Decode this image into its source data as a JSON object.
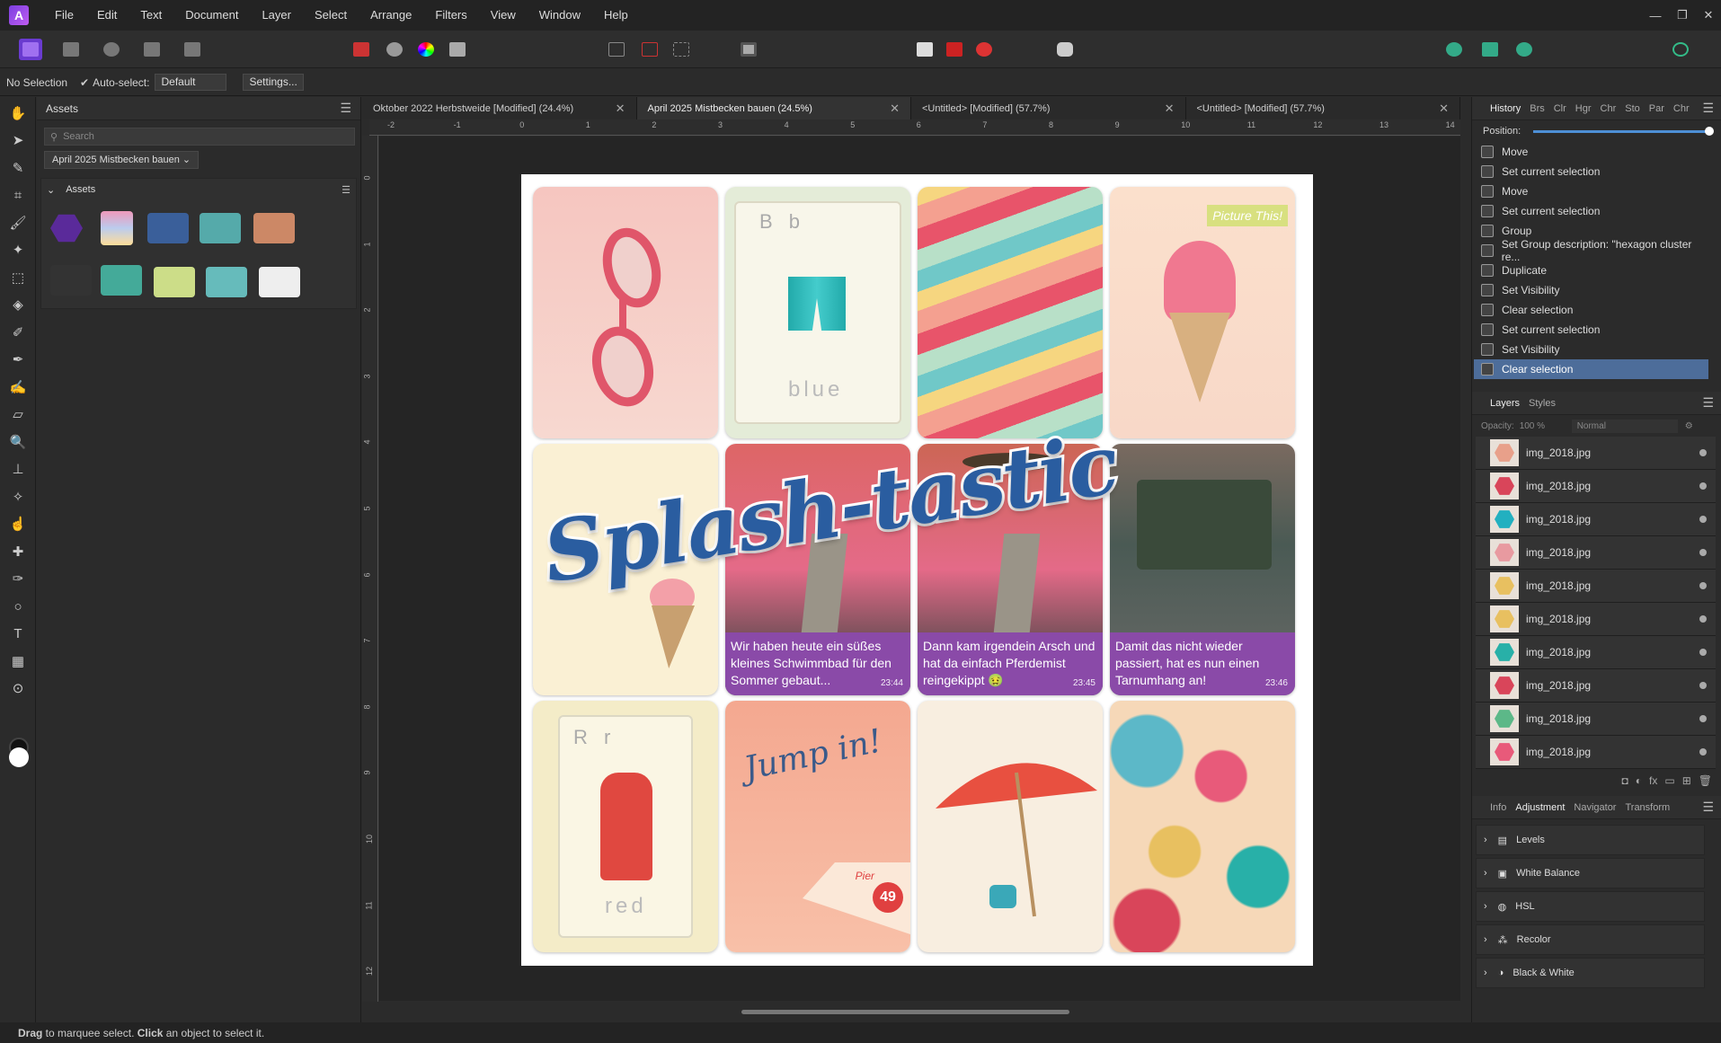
{
  "menubar": {
    "items": [
      "File",
      "Edit",
      "Text",
      "Document",
      "Layer",
      "Select",
      "Arrange",
      "Filters",
      "View",
      "Window",
      "Help"
    ]
  },
  "context": {
    "selection": "No Selection",
    "autoselect_label": "Auto-select:",
    "autoselect_value": "Default",
    "settings": "Settings..."
  },
  "assets": {
    "title": "Assets",
    "search_placeholder": "Search",
    "category": "April 2025 Mistbecken bauen",
    "subcategory": "Assets"
  },
  "tabs": [
    "Oktober 2022 Herbstweide [Modified] (24.4%)",
    "April 2025 Mistbecken bauen (24.5%)",
    "<Untitled> [Modified] (57.7%)",
    "<Untitled> [Modified] (57.7%)"
  ],
  "ruler_h": [
    "-2",
    "-1",
    "0",
    "1",
    "2",
    "3",
    "4",
    "5",
    "6",
    "7",
    "8",
    "9",
    "10",
    "11",
    "12",
    "13",
    "14"
  ],
  "ruler_v": [
    "0",
    "1",
    "2",
    "3",
    "4",
    "5",
    "6",
    "7",
    "8",
    "9",
    "10",
    "11",
    "12"
  ],
  "doc": {
    "title": "Splash-tastic",
    "card_bb": "B b",
    "card_blue": "blue",
    "card_rr": "R r",
    "card_red": "red",
    "picture_this": "Picture This!",
    "chats": [
      {
        "text": "Wir haben heute ein süßes kleines Schwimmbad für den Sommer gebaut...",
        "time": "23:44"
      },
      {
        "text": "Dann kam irgendein Arsch und hat da einfach Pferdemist reingekippt 🤢",
        "time": "23:45"
      },
      {
        "text": "Damit das nicht wieder passiert, hat es nun einen Tarnumhang an!",
        "time": "23:46"
      }
    ],
    "jump": "Jump in!",
    "pier": "Pier",
    "pier_num": "49"
  },
  "history": {
    "tabs": [
      "History",
      "Brs",
      "Clr",
      "Hgr",
      "Chr",
      "Sto",
      "Par",
      "Chr"
    ],
    "position_label": "Position:",
    "items": [
      "Move",
      "Set current selection",
      "Move",
      "Set current selection",
      "Group",
      "Set Group description: \"hexagon cluster re...",
      "Duplicate",
      "Set Visibility",
      "Clear selection",
      "Set current selection",
      "Set Visibility",
      "Clear selection"
    ]
  },
  "layers": {
    "tabs": [
      "Layers",
      "Styles"
    ],
    "opacity_label": "Opacity:",
    "opacity": "100 %",
    "blend": "Normal",
    "items": [
      "img_2018.jpg",
      "img_2018.jpg",
      "img_2018.jpg",
      "img_2018.jpg",
      "img_2018.jpg",
      "img_2018.jpg",
      "img_2018.jpg",
      "img_2018.jpg",
      "img_2018.jpg",
      "img_2018.jpg"
    ],
    "colors": [
      "#e8a08a",
      "#d9455a",
      "#22b0c0",
      "#e89aa0",
      "#e8c060",
      "#e8c060",
      "#28b0a8",
      "#d9455a",
      "#5cb888",
      "#e85a7a"
    ]
  },
  "adjust": {
    "tabs": [
      "Info",
      "Adjustment",
      "Navigator",
      "Transform"
    ],
    "items": [
      "Levels",
      "White Balance",
      "HSL",
      "Recolor",
      "Black & White"
    ]
  },
  "status": {
    "drag": "Drag",
    "t1": " to marquee select. ",
    "click": "Click",
    "t2": " an object to select it."
  }
}
